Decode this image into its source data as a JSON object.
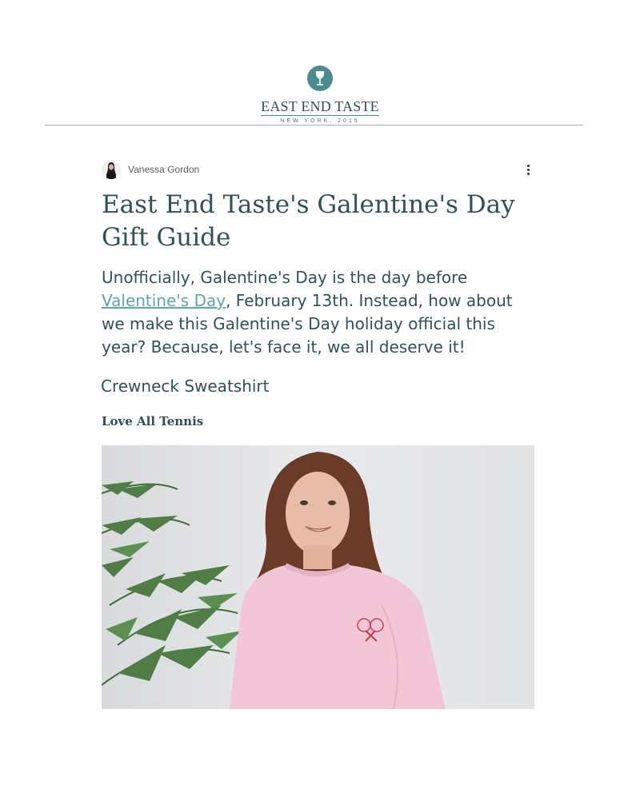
{
  "header": {
    "logo_name": "EAST END TASTE",
    "logo_sub": "NEW YORK, 2015"
  },
  "post": {
    "author": "Vanessa Gordon",
    "title": "East End Taste's Galentine's Day Gift Guide",
    "intro_before": "Unofficially, Galentine's Day is the day before ",
    "intro_link": "Valentine's Day",
    "intro_after": ", February 13th. Instead, how about we make this Galentine's Day holiday official this year? Because, let's face it, we all deserve it!",
    "subheading": "Crewneck Sweatshirt",
    "brand": "Love All Tennis"
  },
  "colors": {
    "accent": "#4d8c8e",
    "text": "#2f5257",
    "link": "#5ea5ad"
  }
}
